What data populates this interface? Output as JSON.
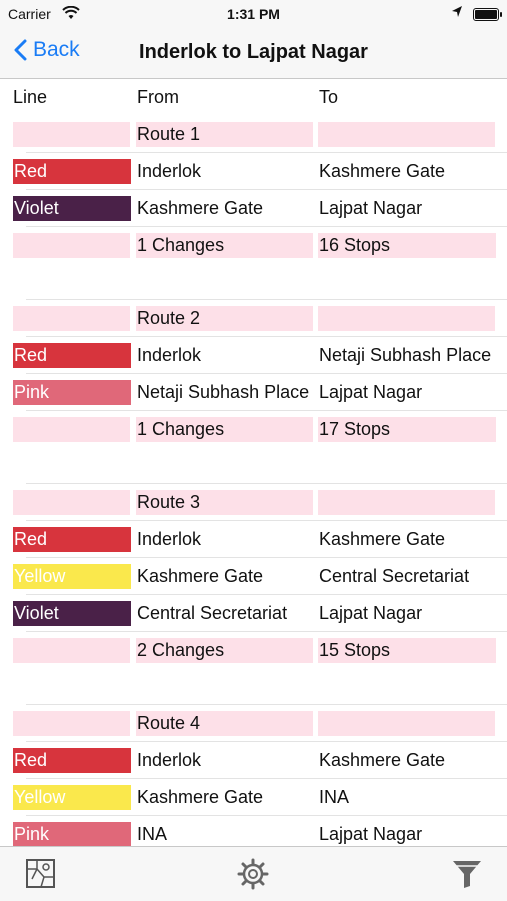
{
  "status": {
    "carrier": "Carrier",
    "time": "1:31 PM"
  },
  "nav": {
    "back": "Back",
    "title": "Inderlok to Lajpat Nagar"
  },
  "headers": {
    "line": "Line",
    "from": "From",
    "to": "To"
  },
  "colors": {
    "Red": "#d7343d",
    "Violet": "#4a2148",
    "Pink": "#e06879",
    "Yellow": "#fae84c",
    "accent": "#1a7cf5",
    "route_bg": "#fde0e8"
  },
  "routes": [
    {
      "title": "Route 1",
      "legs": [
        {
          "line": "Red",
          "from": "Inderlok",
          "to": "Kashmere Gate"
        },
        {
          "line": "Violet",
          "from": "Kashmere Gate",
          "to": "Lajpat Nagar"
        }
      ],
      "changes": "1 Changes",
      "stops": "16 Stops"
    },
    {
      "title": "Route 2",
      "legs": [
        {
          "line": "Red",
          "from": "Inderlok",
          "to": "Netaji Subhash Place"
        },
        {
          "line": "Pink",
          "from": "Netaji Subhash Place",
          "to": "Lajpat Nagar"
        }
      ],
      "changes": "1 Changes",
      "stops": "17 Stops"
    },
    {
      "title": "Route 3",
      "legs": [
        {
          "line": "Red",
          "from": "Inderlok",
          "to": "Kashmere Gate"
        },
        {
          "line": "Yellow",
          "from": "Kashmere Gate",
          "to": "Central Secretariat"
        },
        {
          "line": "Violet",
          "from": "Central Secretariat",
          "to": "Lajpat Nagar"
        }
      ],
      "changes": "2 Changes",
      "stops": "15 Stops"
    },
    {
      "title": "Route 4",
      "legs": [
        {
          "line": "Red",
          "from": "Inderlok",
          "to": "Kashmere Gate"
        },
        {
          "line": "Yellow",
          "from": "Kashmere Gate",
          "to": "INA"
        },
        {
          "line": "Pink",
          "from": "INA",
          "to": "Lajpat Nagar"
        }
      ]
    }
  ],
  "tabbar": {
    "items": [
      "map-icon",
      "gear-icon",
      "filter-icon"
    ]
  }
}
